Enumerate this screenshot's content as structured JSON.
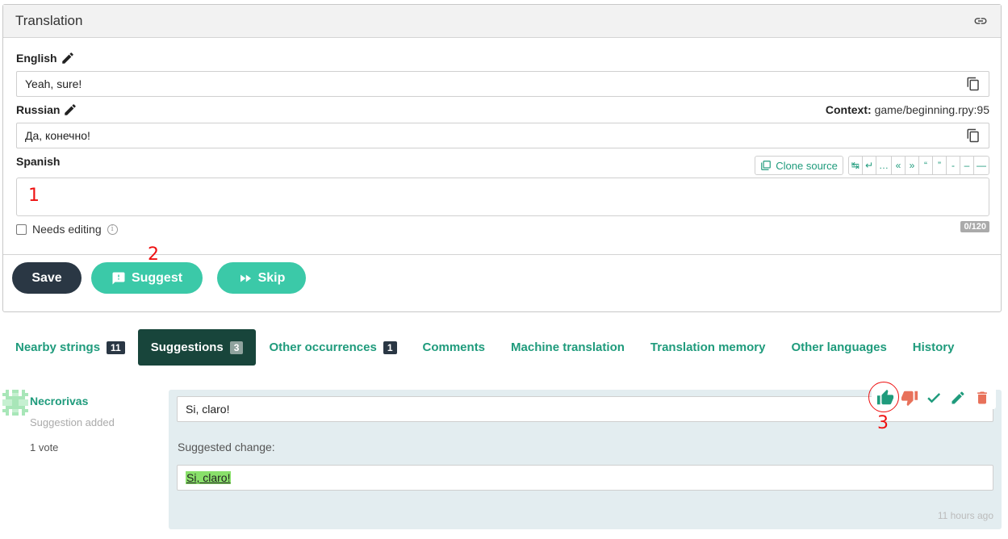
{
  "panel": {
    "title": "Translation",
    "icons": {
      "link": "link-icon"
    }
  },
  "source": {
    "english_label": "English",
    "english_value": "Yeah, sure!",
    "russian_label": "Russian",
    "russian_value": "Да, конечно!",
    "context_label": "Context:",
    "context_value": "game/beginning.rpy:95"
  },
  "target": {
    "label": "Spanish",
    "value": "",
    "clone_label": "Clone source",
    "special_chars": [
      "↹",
      "↵",
      "…",
      "«",
      "»",
      "“",
      "”",
      "-",
      "–",
      "—"
    ],
    "counter": "0/120",
    "needs_editing_label": "Needs editing"
  },
  "buttons": {
    "save": "Save",
    "suggest": "Suggest",
    "skip": "Skip"
  },
  "annotations": {
    "one": "1",
    "two": "2",
    "three": "3"
  },
  "tabs": [
    {
      "label": "Nearby strings",
      "badge": "11"
    },
    {
      "label": "Suggestions",
      "badge": "3"
    },
    {
      "label": "Other occurrences",
      "badge": "1"
    },
    {
      "label": "Comments"
    },
    {
      "label": "Machine translation"
    },
    {
      "label": "Translation memory"
    },
    {
      "label": "Other languages"
    },
    {
      "label": "History"
    }
  ],
  "suggestion": {
    "author": "Necrorivas",
    "event": "Suggestion added",
    "votes": "1 vote",
    "current_value": "Si, claro!",
    "change_label": "Suggested change:",
    "change_value": "Si, claro!",
    "time": "11 hours ago"
  },
  "colors": {
    "accent": "#1f9b7c",
    "teal_button": "#3bc9a8",
    "dark": "#2a3744",
    "active_tab": "#18453b",
    "danger": "#e8715a",
    "annotation": "#e11111"
  }
}
